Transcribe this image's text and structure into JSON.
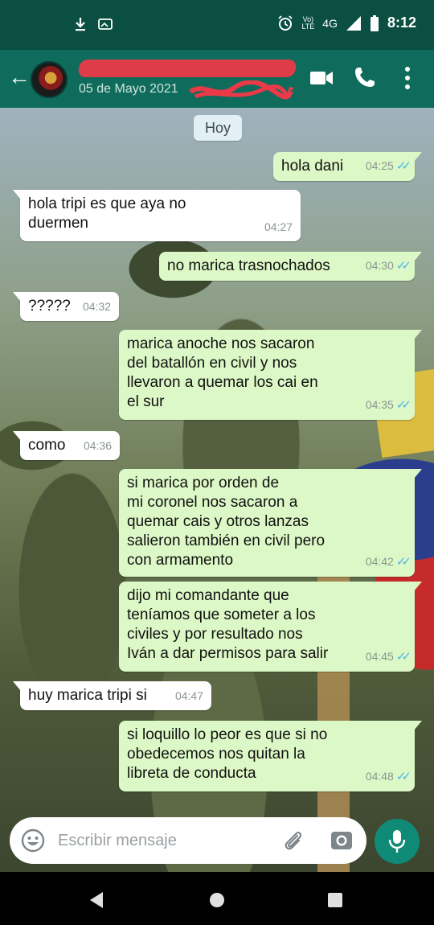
{
  "status_bar": {
    "icons": [
      "download-icon",
      "photo-icon",
      "alarm-icon",
      "volte-icon",
      "signal-icon",
      "battery-icon"
    ],
    "vo_lte_top": "Vo)",
    "vo_lte_bottom": "LTE",
    "network": "4G",
    "time": "8:12"
  },
  "header": {
    "subtitle": "05 de Mayo 2021",
    "icons": [
      "back-arrow-icon",
      "video-call-icon",
      "phone-icon",
      "more-vert-icon"
    ]
  },
  "chat": {
    "date_chip": "Hoy",
    "messages": [
      {
        "direction": "out",
        "text": "hola dani",
        "time": "04:25",
        "status": "read"
      },
      {
        "direction": "in",
        "text": "hola tripi es que aya no\nduermen",
        "time": "04:27"
      },
      {
        "direction": "out",
        "text": "no marica trasnochados",
        "time": "04:30",
        "status": "read"
      },
      {
        "direction": "in",
        "text": "?????",
        "time": "04:32"
      },
      {
        "direction": "out",
        "text": "marica anoche nos sacaron\ndel batallón en civil y nos\nllevaron a quemar los cai en\nel sur",
        "time": "04:35",
        "status": "read"
      },
      {
        "direction": "in",
        "text": "como",
        "time": "04:36"
      },
      {
        "direction": "out",
        "text": "si marica por orden de\nmi coronel nos sacaron a\nquemar cais y otros lanzas\nsalieron también en civil pero\ncon armamento",
        "time": "04:42",
        "status": "read"
      },
      {
        "direction": "out",
        "text": "dijo mi comandante que\nteníamos que someter a los\nciviles y por resultado nos\nIván a dar permisos para salir",
        "time": "04:45",
        "status": "read"
      },
      {
        "direction": "in",
        "text": "huy marica tripi si",
        "time": "04:47"
      },
      {
        "direction": "out",
        "text": "si loquillo lo peor es que si no\nobedecemos nos quitan la\nlibreta de conducta",
        "time": "04:48",
        "status": "read"
      }
    ]
  },
  "composer": {
    "placeholder": "Escribir mensaje",
    "icons": [
      "emoji-icon",
      "attach-icon",
      "camera-icon",
      "mic-icon"
    ]
  },
  "colors": {
    "status_bar": "#0b4f43",
    "app_bar": "#0f6b5b",
    "outgoing_bubble": "#dcf8c6",
    "incoming_bubble": "#ffffff",
    "read_ticks": "#4fb6ec",
    "mic_button": "#0f8a76"
  }
}
